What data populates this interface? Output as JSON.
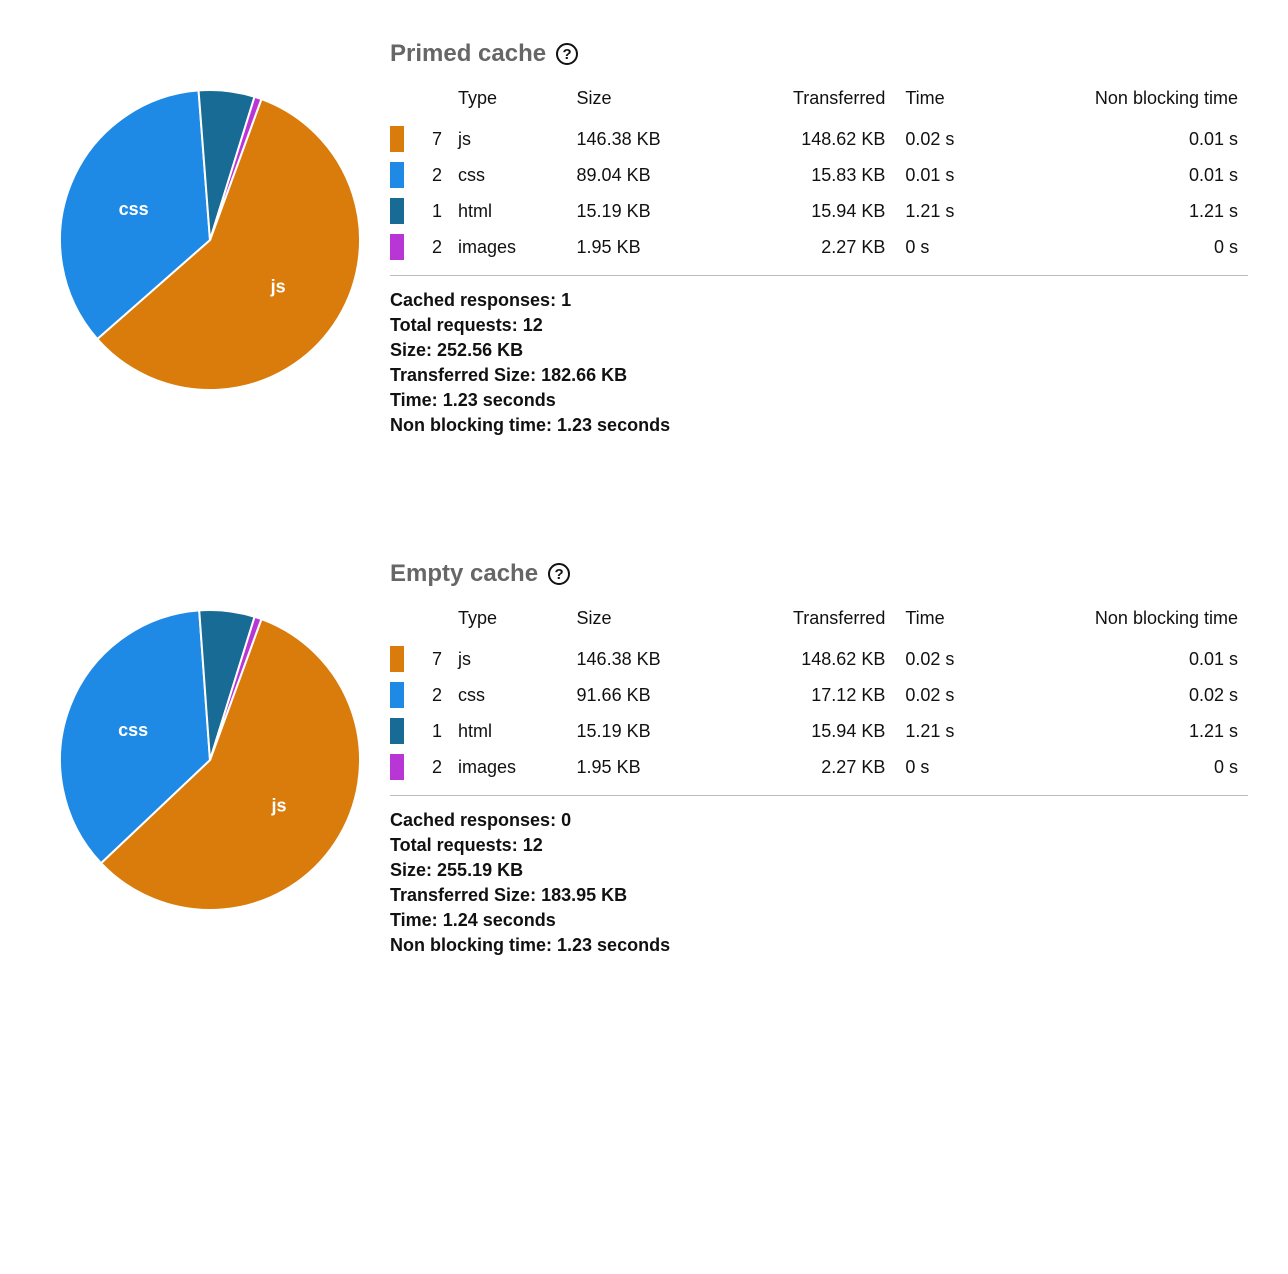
{
  "colors": {
    "js": "#D97C0B",
    "css": "#1F8AE6",
    "html": "#176B94",
    "images": "#B836D6"
  },
  "table_headers": {
    "type": "Type",
    "size": "Size",
    "transferred": "Transferred",
    "time": "Time",
    "nbt": "Non blocking time"
  },
  "summary_labels": {
    "cached": "Cached responses:",
    "total": "Total requests:",
    "size": "Size:",
    "tsize": "Transferred Size:",
    "time": "Time:",
    "nbt": "Non blocking time:"
  },
  "sections": [
    {
      "id": "primed",
      "title": "Primed cache",
      "rows": [
        {
          "color": "js",
          "count": "7",
          "type": "js",
          "size": "146.38 KB",
          "transferred": "148.62 KB",
          "time": "0.02 s",
          "nbt": "0.01 s"
        },
        {
          "color": "css",
          "count": "2",
          "type": "css",
          "size": "89.04 KB",
          "transferred": "15.83 KB",
          "time": "0.01 s",
          "nbt": "0.01 s"
        },
        {
          "color": "html",
          "count": "1",
          "type": "html",
          "size": "15.19 KB",
          "transferred": "15.94 KB",
          "time": "1.21 s",
          "nbt": "1.21 s"
        },
        {
          "color": "images",
          "count": "2",
          "type": "images",
          "size": "1.95 KB",
          "transferred": "2.27 KB",
          "time": "0 s",
          "nbt": "0 s"
        }
      ],
      "summary": {
        "cached": "1",
        "total": "12",
        "size": "252.56 KB",
        "tsize": "182.66 KB",
        "time": "1.23 seconds",
        "nbt": "1.23 seconds"
      }
    },
    {
      "id": "empty",
      "title": "Empty cache",
      "rows": [
        {
          "color": "js",
          "count": "7",
          "type": "js",
          "size": "146.38 KB",
          "transferred": "148.62 KB",
          "time": "0.02 s",
          "nbt": "0.01 s"
        },
        {
          "color": "css",
          "count": "2",
          "type": "css",
          "size": "91.66 KB",
          "transferred": "17.12 KB",
          "time": "0.02 s",
          "nbt": "0.02 s"
        },
        {
          "color": "html",
          "count": "1",
          "type": "html",
          "size": "15.19 KB",
          "transferred": "15.94 KB",
          "time": "1.21 s",
          "nbt": "1.21 s"
        },
        {
          "color": "images",
          "count": "2",
          "type": "images",
          "size": "1.95 KB",
          "transferred": "2.27 KB",
          "time": "0 s",
          "nbt": "0 s"
        }
      ],
      "summary": {
        "cached": "0",
        "total": "12",
        "size": "255.19 KB",
        "tsize": "183.95 KB",
        "time": "1.24 seconds",
        "nbt": "1.23 seconds"
      }
    }
  ],
  "chart_data": [
    {
      "type": "pie",
      "title": "Primed cache — size by type (KB)",
      "categories": [
        "js",
        "css",
        "html",
        "images"
      ],
      "values": [
        146.38,
        89.04,
        15.19,
        1.95
      ],
      "colors": [
        "#D97C0B",
        "#1F8AE6",
        "#176B94",
        "#B836D6"
      ],
      "labels_shown": [
        "js",
        "css"
      ]
    },
    {
      "type": "pie",
      "title": "Empty cache — size by type (KB)",
      "categories": [
        "js",
        "css",
        "html",
        "images"
      ],
      "values": [
        146.38,
        91.66,
        15.19,
        1.95
      ],
      "colors": [
        "#D97C0B",
        "#1F8AE6",
        "#176B94",
        "#B836D6"
      ],
      "labels_shown": [
        "js",
        "css"
      ]
    }
  ]
}
